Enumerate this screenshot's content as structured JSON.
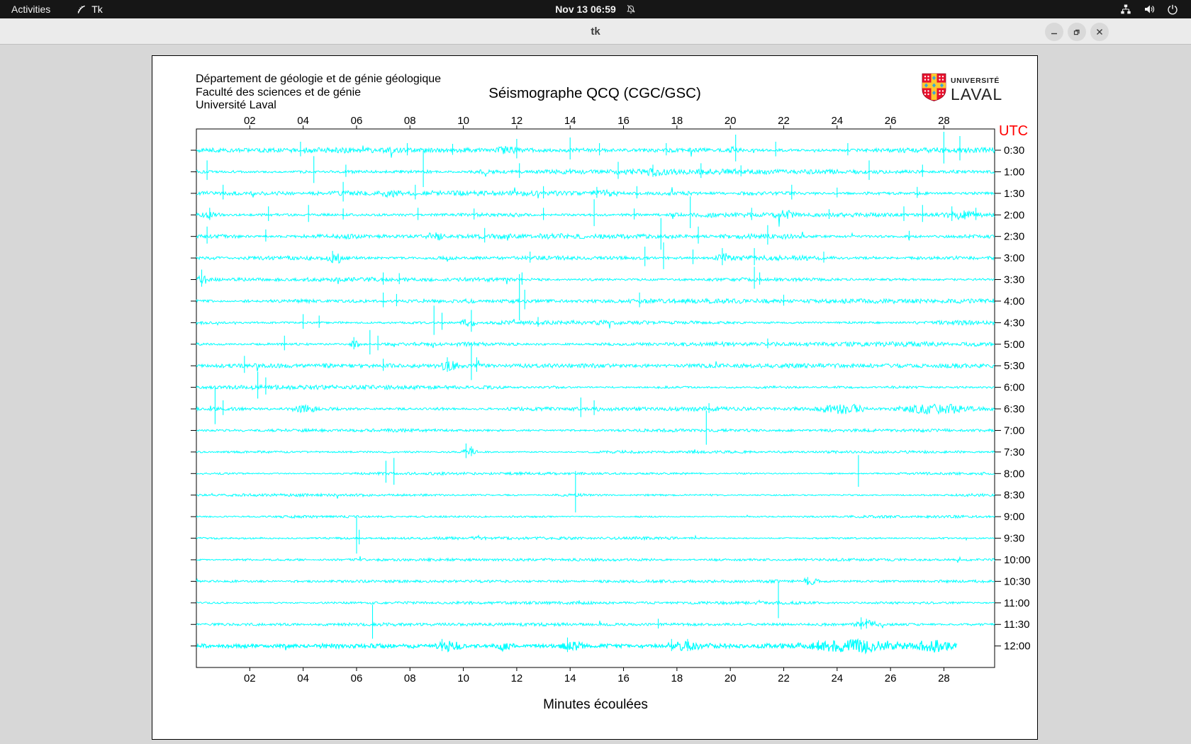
{
  "topbar": {
    "activities_label": "Activities",
    "app_name": "Tk",
    "clock": "Nov 13 06:59"
  },
  "titlebar": {
    "title": "tk"
  },
  "canvas": {
    "header_lines": [
      "Département de géologie et de génie géologique",
      "Faculté des sciences et de génie",
      "Université Laval"
    ],
    "title": "Séismographe QCQ (CGC/GSC)",
    "utc_label": "UTC",
    "xlabel": "Minutes écoulées",
    "logo_small": "UNIVERSITÉ",
    "logo_large": "LAVAL",
    "colors": {
      "trace": "#00ffff",
      "axis": "#000000",
      "utc": "#ff0000",
      "laval_red": "#e8112d",
      "laval_yellow": "#fdc82f",
      "laval_blue": "#3aa5dc"
    },
    "x_tick_labels": [
      "02",
      "04",
      "06",
      "08",
      "10",
      "12",
      "14",
      "16",
      "18",
      "20",
      "22",
      "24",
      "26",
      "28"
    ],
    "x_max": 29.9,
    "trace_labels": [
      "0:30",
      "1:00",
      "1:30",
      "2:00",
      "2:30",
      "3:00",
      "3:30",
      "4:00",
      "4:30",
      "5:00",
      "5:30",
      "6:00",
      "6:30",
      "7:00",
      "7:30",
      "8:00",
      "8:30",
      "9:00",
      "9:30",
      "10:00",
      "10:30",
      "11:00",
      "11:30",
      "12:00"
    ],
    "traces": [
      {
        "noise": 2.4,
        "end": 29.9,
        "spikes": [
          [
            3.9,
            12
          ],
          [
            7.9,
            10
          ],
          [
            9.6,
            9
          ],
          [
            12.0,
            16
          ],
          [
            14.0,
            18
          ],
          [
            15.1,
            10
          ],
          [
            17.6,
            10
          ],
          [
            20.2,
            22
          ],
          [
            21.7,
            12
          ],
          [
            24.4,
            10
          ],
          [
            28.0,
            26
          ],
          [
            28.6,
            20
          ]
        ],
        "bursts": [
          [
            11.2,
            0.8,
            3
          ],
          [
            19.8,
            0.7,
            3
          ]
        ]
      },
      {
        "noise": 2.5,
        "end": 29.9,
        "spikes": [
          [
            0.4,
            16
          ],
          [
            4.4,
            22
          ],
          [
            5.6,
            10
          ],
          [
            8.5,
            30
          ],
          [
            12.1,
            12
          ],
          [
            15.8,
            14
          ],
          [
            17.1,
            10
          ],
          [
            18.9,
            12
          ],
          [
            20.4,
            9
          ],
          [
            25.2,
            16
          ],
          [
            27.2,
            10
          ]
        ],
        "bursts": [
          [
            16.8,
            0.9,
            3
          ]
        ]
      },
      {
        "noise": 2.3,
        "end": 29.9,
        "spikes": [
          [
            1.0,
            12
          ],
          [
            5.5,
            16
          ],
          [
            8.2,
            12
          ],
          [
            13.0,
            10
          ],
          [
            15.0,
            9
          ],
          [
            16.5,
            10
          ],
          [
            22.3,
            12
          ],
          [
            24.0,
            8
          ],
          [
            27.0,
            9
          ]
        ],
        "bursts": [
          [
            6.9,
            0.8,
            3
          ],
          [
            14.7,
            1.2,
            3
          ]
        ]
      },
      {
        "noise": 2.6,
        "end": 29.9,
        "spikes": [
          [
            0.5,
            10
          ],
          [
            2.7,
            12
          ],
          [
            4.2,
            14
          ],
          [
            5.5,
            9
          ],
          [
            8.3,
            10
          ],
          [
            10.4,
            9
          ],
          [
            13.0,
            10
          ],
          [
            14.9,
            22
          ],
          [
            16.4,
            9
          ],
          [
            18.5,
            26
          ],
          [
            20.8,
            10
          ],
          [
            23.7,
            8
          ],
          [
            26.5,
            12
          ],
          [
            27.2,
            14
          ],
          [
            28.3,
            12
          ],
          [
            29.2,
            10
          ]
        ],
        "bursts": [
          [
            0.2,
            0.7,
            4
          ],
          [
            21.5,
            1.0,
            4
          ],
          [
            28.0,
            1.5,
            4
          ]
        ]
      },
      {
        "noise": 2.4,
        "end": 29.9,
        "spikes": [
          [
            0.4,
            14
          ],
          [
            2.6,
            10
          ],
          [
            10.8,
            12
          ],
          [
            17.4,
            26
          ],
          [
            18.8,
            14
          ],
          [
            21.4,
            16
          ],
          [
            26.7,
            8
          ]
        ],
        "bursts": [
          [
            8.5,
            0.8,
            3
          ]
        ]
      },
      {
        "noise": 2.3,
        "end": 29.9,
        "spikes": [
          [
            5.1,
            10
          ],
          [
            12.5,
            9
          ],
          [
            16.8,
            16
          ],
          [
            17.5,
            22
          ],
          [
            18.6,
            12
          ],
          [
            19.7,
            14
          ],
          [
            20.9,
            14
          ],
          [
            23.5,
            9
          ]
        ],
        "bursts": [
          [
            4.8,
            0.9,
            5
          ],
          [
            19.4,
            0.8,
            4
          ]
        ]
      },
      {
        "noise": 2.2,
        "end": 29.9,
        "spikes": [
          [
            0.2,
            14
          ],
          [
            7.0,
            10
          ],
          [
            7.6,
            9
          ],
          [
            12.2,
            10
          ],
          [
            20.9,
            18
          ],
          [
            21.1,
            10
          ]
        ],
        "bursts": [
          [
            0.0,
            0.5,
            4
          ]
        ]
      },
      {
        "noise": 2.1,
        "end": 29.9,
        "spikes": [
          [
            7.0,
            12
          ],
          [
            7.5,
            10
          ],
          [
            12.1,
            38
          ],
          [
            12.3,
            16
          ],
          [
            16.6,
            12
          ],
          [
            22.0,
            9
          ]
        ],
        "bursts": []
      },
      {
        "noise": 2.2,
        "end": 29.9,
        "spikes": [
          [
            4.0,
            12
          ],
          [
            4.6,
            10
          ],
          [
            8.9,
            24
          ],
          [
            9.2,
            14
          ],
          [
            10.3,
            18
          ],
          [
            12.8,
            8
          ]
        ],
        "bursts": [
          [
            9.8,
            0.8,
            4
          ]
        ]
      },
      {
        "noise": 2.1,
        "end": 29.9,
        "spikes": [
          [
            3.3,
            12
          ],
          [
            5.9,
            10
          ],
          [
            6.5,
            20
          ],
          [
            6.8,
            12
          ],
          [
            21.4,
            8
          ]
        ],
        "bursts": [
          [
            5.6,
            0.6,
            4
          ]
        ]
      },
      {
        "noise": 2.0,
        "end": 29.9,
        "spikes": [
          [
            1.8,
            14
          ],
          [
            7.0,
            10
          ],
          [
            9.4,
            12
          ],
          [
            10.3,
            28
          ],
          [
            10.5,
            12
          ]
        ],
        "bursts": [
          [
            9.0,
            0.9,
            4
          ]
        ]
      },
      {
        "noise": 1.9,
        "end": 29.9,
        "spikes": [
          [
            2.3,
            22
          ],
          [
            2.6,
            14
          ]
        ],
        "bursts": []
      },
      {
        "noise": 2.2,
        "end": 29.9,
        "spikes": [
          [
            0.7,
            30
          ],
          [
            1.0,
            12
          ],
          [
            14.4,
            16
          ],
          [
            14.9,
            12
          ],
          [
            19.2,
            8
          ]
        ],
        "bursts": [
          [
            3.5,
            1.2,
            3
          ],
          [
            23.2,
            2.0,
            5
          ],
          [
            25.8,
            3.5,
            5
          ]
        ]
      },
      {
        "noise": 1.4,
        "end": 29.9,
        "spikes": [
          [
            19.1,
            28
          ]
        ],
        "bursts": []
      },
      {
        "noise": 1.4,
        "end": 29.9,
        "spikes": [
          [
            10.1,
            12
          ],
          [
            10.3,
            8
          ]
        ],
        "bursts": [
          [
            9.9,
            0.7,
            4
          ]
        ]
      },
      {
        "noise": 1.3,
        "end": 29.9,
        "spikes": [
          [
            7.1,
            18
          ],
          [
            7.4,
            22
          ],
          [
            24.8,
            26
          ]
        ],
        "bursts": []
      },
      {
        "noise": 1.3,
        "end": 29.9,
        "spikes": [
          [
            14.2,
            34
          ]
        ],
        "bursts": []
      },
      {
        "noise": 1.2,
        "end": 29.9,
        "spikes": [],
        "bursts": []
      },
      {
        "noise": 1.3,
        "end": 29.9,
        "spikes": [
          [
            6.0,
            30
          ],
          [
            6.1,
            12
          ]
        ],
        "bursts": []
      },
      {
        "noise": 1.2,
        "end": 29.9,
        "spikes": [],
        "bursts": []
      },
      {
        "noise": 1.3,
        "end": 29.9,
        "spikes": [
          [
            22.9,
            6
          ]
        ],
        "bursts": [
          [
            22.6,
            0.8,
            4
          ]
        ]
      },
      {
        "noise": 1.3,
        "end": 29.9,
        "spikes": [
          [
            21.8,
            30
          ]
        ],
        "bursts": []
      },
      {
        "noise": 1.5,
        "end": 29.9,
        "spikes": [
          [
            6.6,
            28
          ],
          [
            17.3,
            8
          ],
          [
            24.9,
            10
          ],
          [
            25.1,
            8
          ]
        ],
        "bursts": [
          [
            24.6,
            1.0,
            4
          ]
        ]
      },
      {
        "noise": 2.6,
        "end": 28.5,
        "spikes": [
          [
            9.2,
            10
          ],
          [
            13.9,
            12
          ],
          [
            17.8,
            10
          ],
          [
            18.4,
            10
          ],
          [
            23.3,
            8
          ],
          [
            25.0,
            8
          ]
        ],
        "bursts": [
          [
            8.8,
            1.2,
            5
          ],
          [
            11.0,
            1.0,
            5
          ],
          [
            13.5,
            1.2,
            5
          ],
          [
            17.5,
            1.5,
            5
          ],
          [
            22.8,
            3.8,
            6
          ],
          [
            26.8,
            1.5,
            5
          ]
        ]
      }
    ]
  }
}
